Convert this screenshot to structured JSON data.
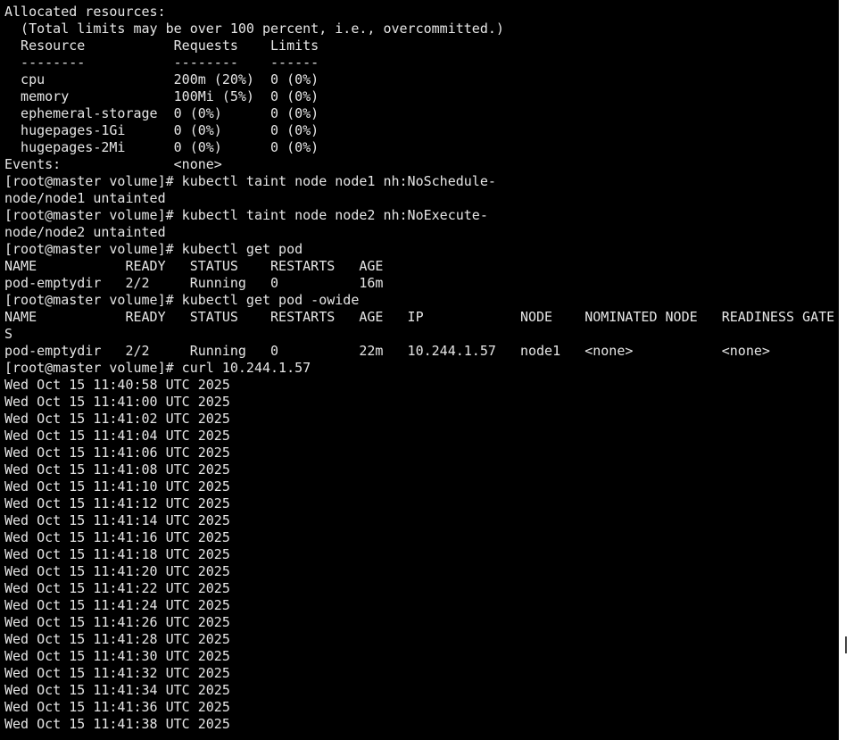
{
  "terminal": {
    "lines": [
      "Allocated resources:",
      "  (Total limits may be over 100 percent, i.e., overcommitted.)",
      "  Resource           Requests    Limits",
      "  --------           --------    ------",
      "  cpu                200m (20%)  0 (0%)",
      "  memory             100Mi (5%)  0 (0%)",
      "  ephemeral-storage  0 (0%)      0 (0%)",
      "  hugepages-1Gi      0 (0%)      0 (0%)",
      "  hugepages-2Mi      0 (0%)      0 (0%)",
      "Events:              <none>",
      "[root@master volume]# kubectl taint node node1 nh:NoSchedule-",
      "node/node1 untainted",
      "[root@master volume]# kubectl taint node node2 nh:NoExecute-",
      "node/node2 untainted",
      "[root@master volume]# kubectl get pod",
      "NAME           READY   STATUS    RESTARTS   AGE",
      "pod-emptydir   2/2     Running   0          16m",
      "[root@master volume]# kubectl get pod -owide",
      "NAME           READY   STATUS    RESTARTS   AGE   IP            NODE    NOMINATED NODE   READINESS GATE",
      "S",
      "pod-emptydir   2/2     Running   0          22m   10.244.1.57   node1   <none>           <none>",
      "[root@master volume]# curl 10.244.1.57",
      "Wed Oct 15 11:40:58 UTC 2025",
      "Wed Oct 15 11:41:00 UTC 2025",
      "Wed Oct 15 11:41:02 UTC 2025",
      "Wed Oct 15 11:41:04 UTC 2025",
      "Wed Oct 15 11:41:06 UTC 2025",
      "Wed Oct 15 11:41:08 UTC 2025",
      "Wed Oct 15 11:41:10 UTC 2025",
      "Wed Oct 15 11:41:12 UTC 2025",
      "Wed Oct 15 11:41:14 UTC 2025",
      "Wed Oct 15 11:41:16 UTC 2025",
      "Wed Oct 15 11:41:18 UTC 2025",
      "Wed Oct 15 11:41:20 UTC 2025",
      "Wed Oct 15 11:41:22 UTC 2025",
      "Wed Oct 15 11:41:24 UTC 2025",
      "Wed Oct 15 11:41:26 UTC 2025",
      "Wed Oct 15 11:41:28 UTC 2025",
      "Wed Oct 15 11:41:30 UTC 2025",
      "Wed Oct 15 11:41:32 UTC 2025",
      "Wed Oct 15 11:41:34 UTC 2025",
      "Wed Oct 15 11:41:36 UTC 2025",
      "Wed Oct 15 11:41:38 UTC 2025"
    ]
  },
  "colors": {
    "background": "#000000",
    "text": "#e6e6e6"
  }
}
